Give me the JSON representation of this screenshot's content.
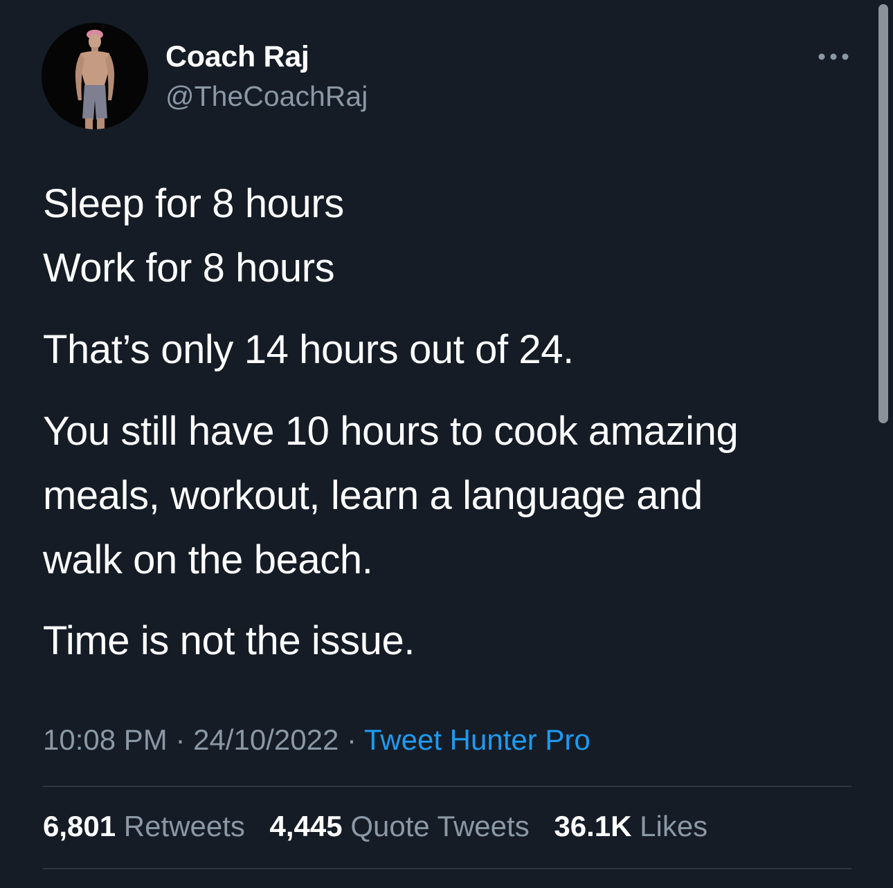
{
  "author": {
    "name": "Coach Raj",
    "handle": "@TheCoachRaj",
    "avatar_icon": "profile-photo"
  },
  "tweet": {
    "lines": [
      "Sleep for 8 hours",
      "Work for 8 hours",
      "That’s only 14 hours out of 24.",
      "You still have 10 hours to cook amazing",
      "meals, workout, learn a language and",
      "walk on the beach.",
      "Time is not the issue."
    ]
  },
  "meta": {
    "time": "10:08 PM",
    "separator": "·",
    "date": "24/10/2022",
    "source": "Tweet Hunter Pro"
  },
  "stats": {
    "retweets_count": "6,801",
    "retweets_label": "Retweets",
    "quotes_count": "4,445",
    "quotes_label": "Quote Tweets",
    "likes_count": "36.1K",
    "likes_label": "Likes"
  },
  "icons": {
    "more": "more-horizontal-icon"
  },
  "colors": {
    "background": "#151c26",
    "text": "#ffffff",
    "secondary": "#8b98a5",
    "link": "#1d9bf0",
    "divider": "#2f3640"
  }
}
